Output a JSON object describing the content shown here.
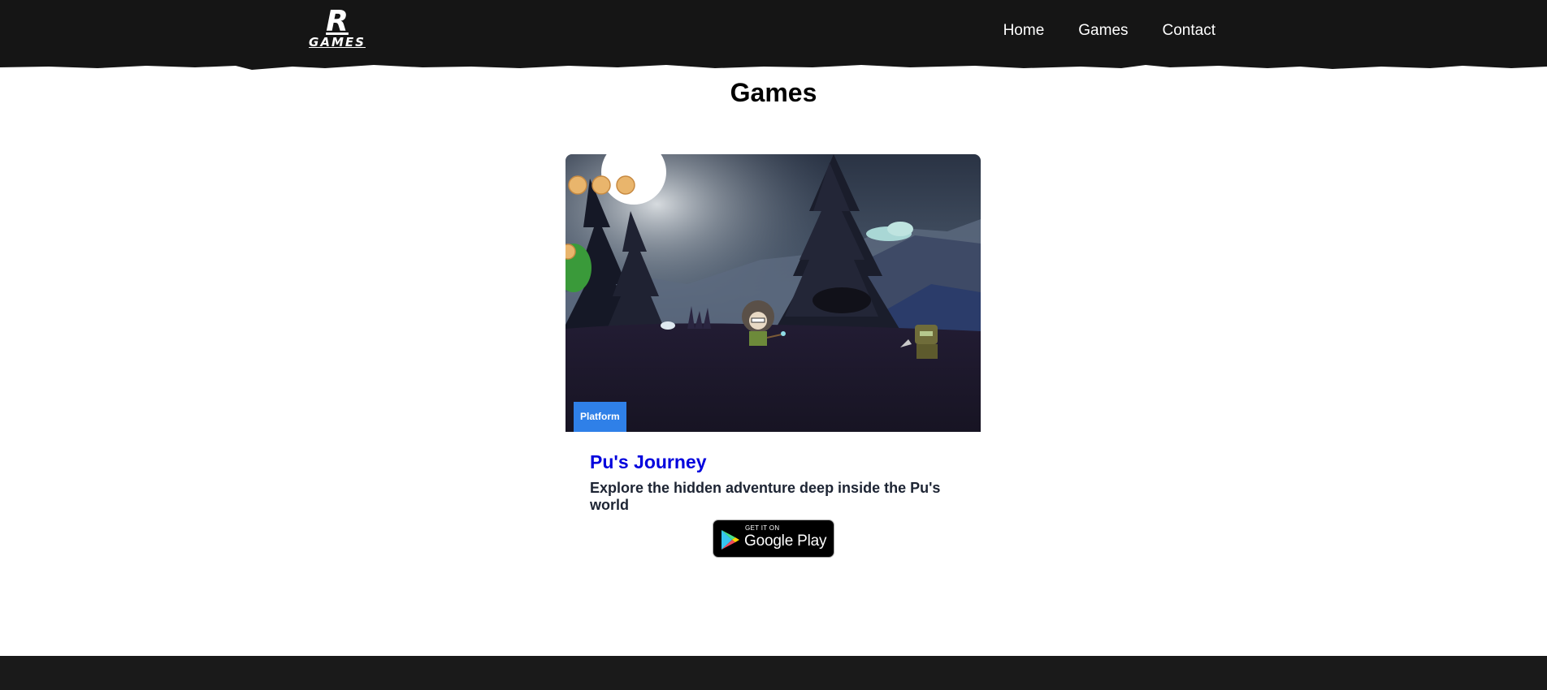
{
  "header": {
    "logo_letter": "R",
    "logo_word": "GAMES",
    "nav": [
      {
        "label": "Home"
      },
      {
        "label": "Games"
      },
      {
        "label": "Contact"
      }
    ]
  },
  "main": {
    "title": "Games",
    "cards": [
      {
        "badge": "Platform",
        "title": "Pu's Journey",
        "description": "Explore the hidden adventure deep inside the Pu's world",
        "store_button": {
          "small": "GET IT ON",
          "big": "Google Play"
        }
      }
    ]
  },
  "colors": {
    "header_bg": "#151515",
    "footer_bg": "#1a1a1a",
    "badge_bg": "#2f80e8",
    "title_link": "#0000dd",
    "description": "#1d2433"
  },
  "icons": [
    "google-play-icon"
  ]
}
